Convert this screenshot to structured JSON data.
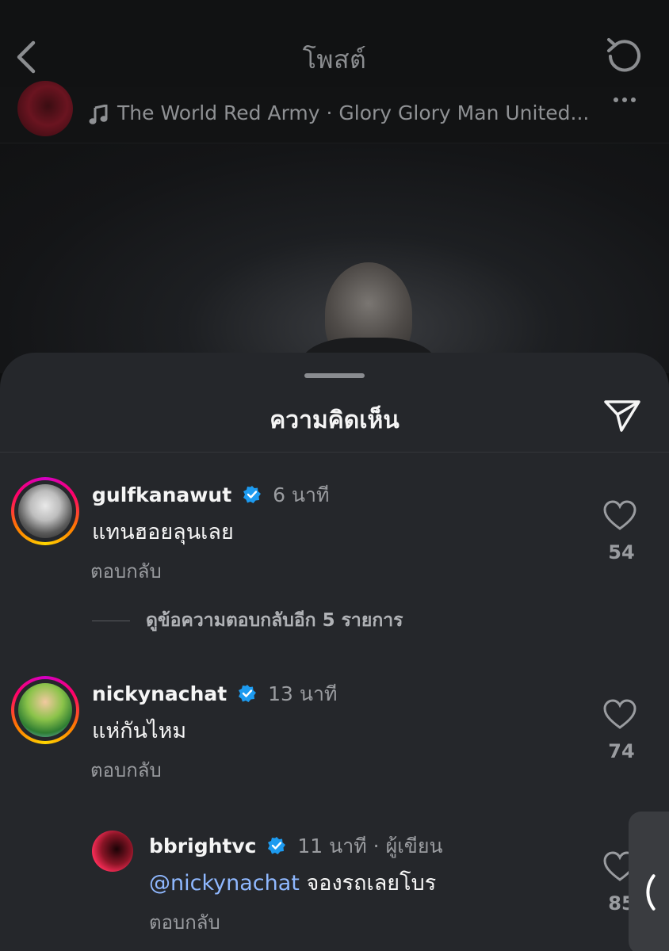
{
  "header": {
    "title": "โพสต์"
  },
  "post": {
    "song": "The World Red Army · Glory Glory Man United..."
  },
  "sheet": {
    "title": "ความคิดเห็น"
  },
  "comments": [
    {
      "username": "gulfkanawut",
      "time": "6 นาที",
      "text": "แทนฮอยลุนเลย",
      "reply": "ตอบกลับ",
      "likes": "54"
    },
    {
      "username": "nickynachat",
      "time": "13 นาที",
      "text": "แห่กันไหม",
      "reply": "ตอบกลับ",
      "likes": "74"
    }
  ],
  "view_replies": "ดูข้อความตอบกลับอีก 5 รายการ",
  "nested_reply": {
    "username": "bbrightvc",
    "meta": "11 นาที · ผู้เขียน",
    "mention": "@nickynachat",
    "text": " จองรถเลยโบร",
    "reply": "ตอบกลับ",
    "likes": "85"
  },
  "colors": {
    "sheet_bg": "#25272b",
    "verified": "#1d9bf0",
    "mention": "#8fb8ff"
  }
}
